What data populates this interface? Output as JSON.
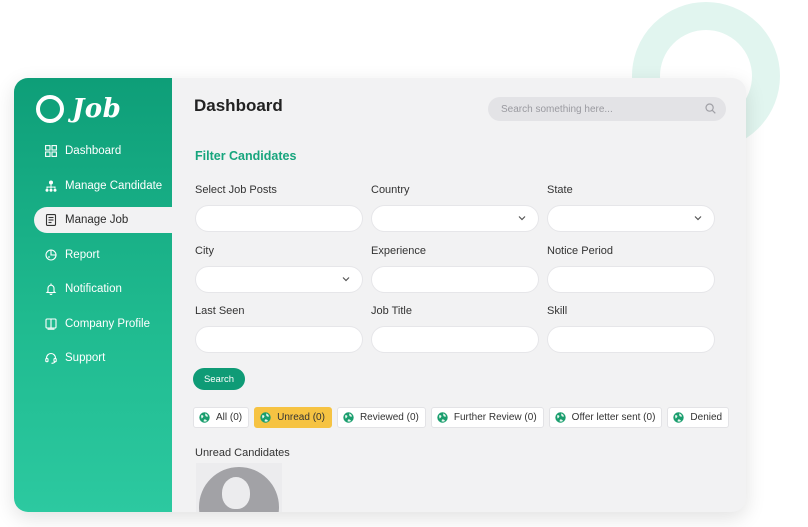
{
  "app": {
    "logo_text": "Job"
  },
  "sidebar": {
    "items": [
      {
        "label": "Dashboard",
        "icon": "grid-icon"
      },
      {
        "label": "Manage Candidate",
        "icon": "org-chart-icon"
      },
      {
        "label": "Manage Job",
        "icon": "document-icon",
        "active": true
      },
      {
        "label": "Report",
        "icon": "report-icon"
      },
      {
        "label": "Notification",
        "icon": "bell-icon"
      },
      {
        "label": "Company Profile",
        "icon": "book-icon"
      },
      {
        "label": "Support",
        "icon": "headset-icon"
      }
    ]
  },
  "header": {
    "title": "Dashboard",
    "search": {
      "placeholder": "Search something here...",
      "icon": "search-icon"
    }
  },
  "filter": {
    "title": "Filter Candidates",
    "fields": [
      {
        "label": "Select Job Posts",
        "value": ""
      },
      {
        "label": "Country",
        "value": ""
      },
      {
        "label": "State",
        "value": ""
      },
      {
        "label": "City",
        "value": ""
      },
      {
        "label": "Experience",
        "value": ""
      },
      {
        "label": "Notice Period",
        "value": ""
      },
      {
        "label": "Last Seen",
        "value": ""
      },
      {
        "label": "Job Title",
        "value": ""
      },
      {
        "label": "Skill",
        "value": ""
      }
    ],
    "search_label": "Search"
  },
  "tabs": [
    {
      "label": "All (0)"
    },
    {
      "label": "Unread (0)",
      "active": true
    },
    {
      "label": "Reviewed (0)"
    },
    {
      "label": "Further Review (0)"
    },
    {
      "label": "Offer letter sent (0)"
    },
    {
      "label": "Denied"
    }
  ],
  "candidates": {
    "section_title": "Unread Candidates"
  },
  "colors": {
    "brand": "#0f9b76",
    "accent_active_tab": "#f6c342",
    "decor_ring": "#e1f5ef"
  }
}
